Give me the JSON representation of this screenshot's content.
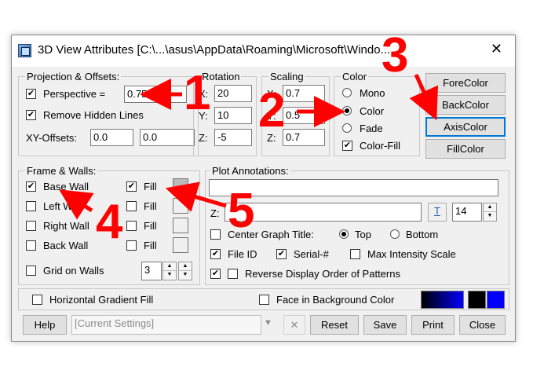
{
  "window": {
    "title": "3D View Attributes [C:\\...\\asus\\AppData\\Roaming\\Microsoft\\Windo...",
    "close_glyph": "✕"
  },
  "projection": {
    "legend": "Projection & Offsets:",
    "perspective_label": "Perspective =",
    "perspective_value": "0.75",
    "perspective_checked": "✔",
    "remove_hidden_label": "Remove Hidden Lines",
    "remove_hidden_checked": "✔",
    "xy_offsets_label": "XY-Offsets:",
    "x_offset": "0.0",
    "y_offset": "0.0"
  },
  "rotation": {
    "legend": "Rotation",
    "x_label": "X:",
    "x_value": "20",
    "y_label": "Y:",
    "y_value": "10",
    "z_label": "Z:",
    "z_value": "-5"
  },
  "scaling": {
    "legend": "Scaling",
    "x_label": "X:",
    "x_value": "0.7",
    "y_label": "Y:",
    "y_value": "0.5",
    "z_label": "Z:",
    "z_value": "0.7"
  },
  "color": {
    "legend": "Color",
    "mono_label": "Mono",
    "color_label": "Color",
    "fade_label": "Fade",
    "color_fill_label": "Color-Fill",
    "color_fill_checked": "✔",
    "selected": "Color"
  },
  "color_buttons": {
    "fore": "ForeColor",
    "back": "BackColor",
    "axis": "AxisColor",
    "fill": "FillColor"
  },
  "frame_walls": {
    "legend": "Frame & Walls:",
    "base_wall_label": "Base Wall",
    "base_wall_checked": "✔",
    "left_wall_label": "Left Wall",
    "right_wall_label": "Right Wall",
    "back_wall_label": "Back Wall",
    "fill_label": "Fill",
    "fill_checked": "✔",
    "grid_label": "Grid on Walls",
    "grid_value": "3"
  },
  "annotations": {
    "legend": "Plot Annotations:",
    "title_value": "",
    "z_label": "Z:",
    "z_value": "",
    "font_size": "14",
    "center_title_label": "Center Graph Title:",
    "top_label": "Top",
    "bottom_label": "Bottom",
    "file_id_label": "File ID",
    "file_id_checked": "✔",
    "serial_label": "Serial-#",
    "serial_checked": "✔",
    "max_intensity_label": "Max Intensity Scale",
    "reverse_label": "Reverse Display Order of Patterns",
    "reverse_outer_checked": "✔"
  },
  "gradient": {
    "horizontal_label": "Horizontal Gradient Fill",
    "face_label": "Face in Background Color"
  },
  "footer": {
    "help": "Help",
    "settings_value": "[Current Settings]",
    "delete_glyph": "✕",
    "reset": "Reset",
    "save": "Save",
    "print": "Print",
    "close": "Close"
  },
  "callouts": {
    "n1": "1",
    "n2": "2",
    "n3": "3",
    "n4": "4",
    "n5": "5"
  },
  "colors": {
    "accent_red": "#ff0000",
    "gradient_start": "#000000",
    "gradient_end": "#0000ff",
    "focus_blue": "#0078d7"
  },
  "icons": {
    "app": "3d-view-app-icon",
    "close": "close-icon",
    "spin": "spinner-arrows-icon",
    "dropdown": "chevron-down-icon",
    "text_tool": "text-font-icon"
  }
}
